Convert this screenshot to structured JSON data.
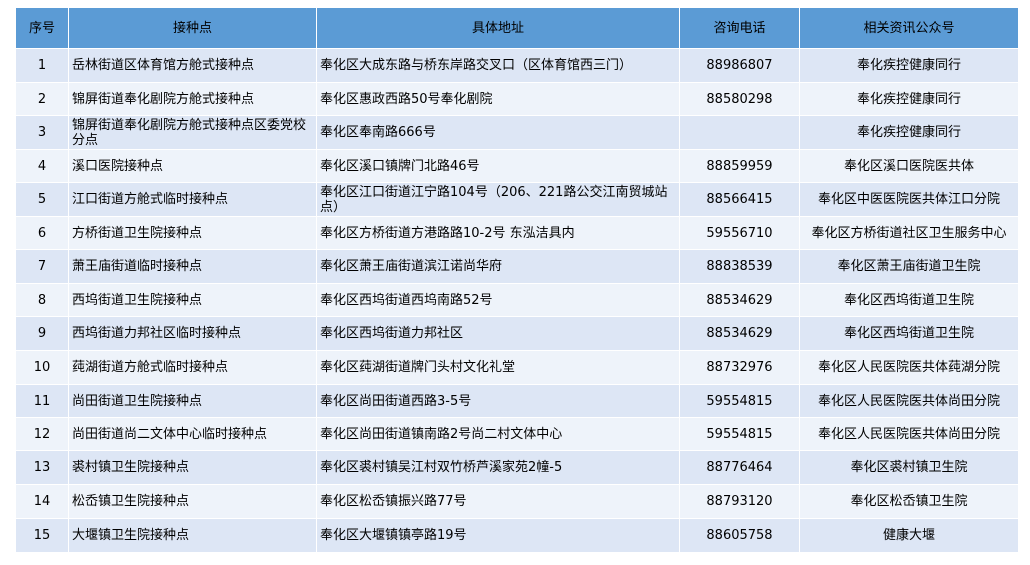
{
  "headers": [
    "序号",
    "接种点",
    "具体地址",
    "咨询电话",
    "相关资讯公众号"
  ],
  "rows": [
    {
      "no": "1",
      "site": "岳林街道区体育馆方舱式接种点",
      "address": "奉化区大成东路与桥东岸路交叉口（区体育馆西三门）",
      "phone": "88986807",
      "account": "奉化疾控健康同行"
    },
    {
      "no": "2",
      "site": "锦屏街道奉化剧院方舱式接种点",
      "address": "奉化区惠政西路50号奉化剧院",
      "phone": "88580298",
      "account": "奉化疾控健康同行"
    },
    {
      "no": "3",
      "site": "锦屏街道奉化剧院方舱式接种点区委党校分点",
      "address": "奉化区奉南路666号",
      "phone": "",
      "account": "奉化疾控健康同行"
    },
    {
      "no": "4",
      "site": "溪口医院接种点",
      "address": "奉化区溪口镇牌门北路46号",
      "phone": "88859959",
      "account": "奉化区溪口医院医共体"
    },
    {
      "no": "5",
      "site": "江口街道方舱式临时接种点",
      "address": "奉化区江口街道江宁路104号（206、221路公交江南贸城站点）",
      "phone": "88566415",
      "account": "奉化区中医医院医共体江口分院"
    },
    {
      "no": "6",
      "site": "方桥街道卫生院接种点",
      "address": "奉化区方桥街道方港路路10-2号 东泓洁具内",
      "phone": "59556710",
      "account": "奉化区方桥街道社区卫生服务中心"
    },
    {
      "no": "7",
      "site": "萧王庙街道临时接种点",
      "address": "奉化区萧王庙街道滨江诺尚华府",
      "phone": "88838539",
      "account": "奉化区萧王庙街道卫生院"
    },
    {
      "no": "8",
      "site": "西坞街道卫生院接种点",
      "address": "奉化区西坞街道西坞南路52号",
      "phone": "88534629",
      "account": "奉化区西坞街道卫生院"
    },
    {
      "no": "9",
      "site": "西坞街道力邦社区临时接种点",
      "address": "奉化区西坞街道力邦社区",
      "phone": "88534629",
      "account": "奉化区西坞街道卫生院"
    },
    {
      "no": "10",
      "site": "莼湖街道方舱式临时接种点",
      "address": "奉化区莼湖街道牌门头村文化礼堂",
      "phone": "88732976",
      "account": "奉化区人民医院医共体莼湖分院"
    },
    {
      "no": "11",
      "site": "尚田街道卫生院接种点",
      "address": "奉化区尚田街道西路3-5号",
      "phone": "59554815",
      "account": "奉化区人民医院医共体尚田分院"
    },
    {
      "no": "12",
      "site": "尚田街道尚二文体中心临时接种点",
      "address": "奉化区尚田街道镇南路2号尚二村文体中心",
      "phone": "59554815",
      "account": "奉化区人民医院医共体尚田分院"
    },
    {
      "no": "13",
      "site": "裘村镇卫生院接种点",
      "address": "奉化区裘村镇吴江村双竹桥芦溪家苑2幢-5",
      "phone": "88776464",
      "account": "奉化区裘村镇卫生院"
    },
    {
      "no": "14",
      "site": "松岙镇卫生院接种点",
      "address": "奉化区松岙镇振兴路77号",
      "phone": "88793120",
      "account": "奉化区松岙镇卫生院"
    },
    {
      "no": "15",
      "site": "大堰镇卫生院接种点",
      "address": "奉化区大堰镇镇亭路19号",
      "phone": "88605758",
      "account": "健康大堰"
    }
  ]
}
